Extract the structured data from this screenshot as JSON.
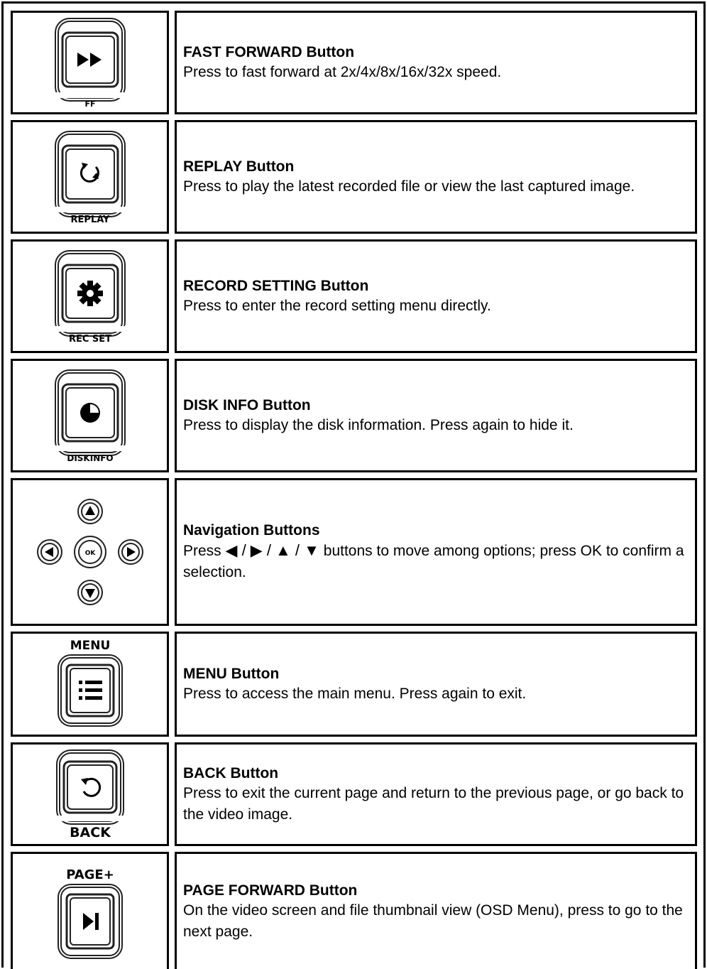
{
  "rows": [
    {
      "title": "FAST FORWARD Button",
      "desc": "Press to fast forward at 2x/4x/8x/16x/32x speed.",
      "icon_label": "FF",
      "icon": "fast-forward-icon"
    },
    {
      "title": "REPLAY Button",
      "desc": "Press to play the latest recorded file or view the last captured image.",
      "icon_label": "REPLAY",
      "icon": "replay-icon"
    },
    {
      "title": "RECORD SETTING Button",
      "desc": "Press to enter the record setting menu directly.",
      "icon_label": "REC SET",
      "icon": "gear-icon"
    },
    {
      "title": "DISK INFO Button",
      "desc": "Press to display the disk information. Press again to hide it.",
      "icon_label": "DISKINFO",
      "icon": "pie-chart-icon"
    },
    {
      "title": "Navigation Buttons",
      "desc_prefix": "Press",
      "desc_arrows": "◀ / ▶ / ▲ / ▼",
      "desc_suffix": "buttons to move among options; press OK to confirm a selection.",
      "icon_label": "OK",
      "icon": "navigation-pad-icon"
    },
    {
      "title": "MENU Button",
      "desc": "Press to access the main menu. Press again to exit.",
      "icon_label": "MENU",
      "icon": "menu-list-icon"
    },
    {
      "title": "BACK Button",
      "desc": "Press to exit the current page and return to the previous page, or go back to the video image.",
      "icon_label": "BACK",
      "icon": "back-arrow-icon"
    },
    {
      "title": "PAGE FORWARD Button",
      "desc": "On the video screen and file thumbnail view (OSD Menu), press to go to the next page.",
      "icon_label": "PAGE+",
      "icon": "skip-next-icon"
    }
  ]
}
